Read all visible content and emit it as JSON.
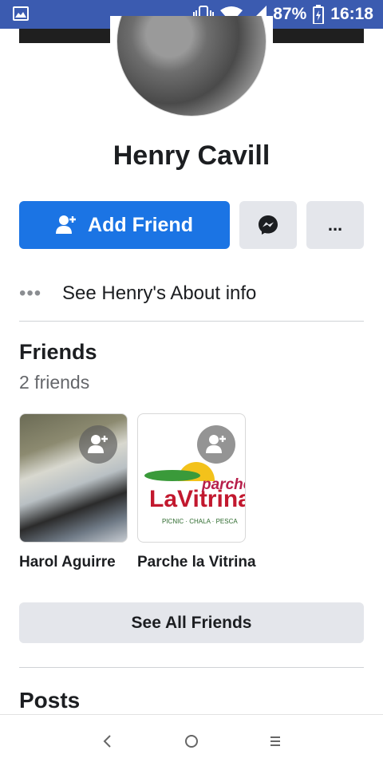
{
  "status_bar": {
    "battery": "87%",
    "time": "16:18"
  },
  "profile": {
    "name": "Henry Cavill"
  },
  "actions": {
    "add_friend_label": "Add Friend",
    "more_label": "..."
  },
  "about": {
    "dots": "•••",
    "label": "See Henry's About info"
  },
  "friends": {
    "title": "Friends",
    "count": "2 friends",
    "items": [
      {
        "name": "Harol Aguirre"
      },
      {
        "name": "Parche la Vitrina",
        "logo_line1": "parche",
        "logo_line2": "LaVitrina",
        "logo_sub": "PICNIC · CHALA · PESCA"
      }
    ],
    "see_all_label": "See All Friends"
  },
  "posts": {
    "title": "Posts"
  },
  "colors": {
    "status_bar": "#3b5bb0",
    "primary_button": "#1b74e4",
    "secondary_button": "#e4e6eb",
    "text_primary": "#1c1e21",
    "text_secondary": "#65676b"
  },
  "icons": [
    "image-icon",
    "vibrate-icon",
    "wifi-icon",
    "signal-icon",
    "battery-icon",
    "add-friend-icon",
    "messenger-icon",
    "back-icon",
    "home-icon",
    "recents-icon"
  ]
}
